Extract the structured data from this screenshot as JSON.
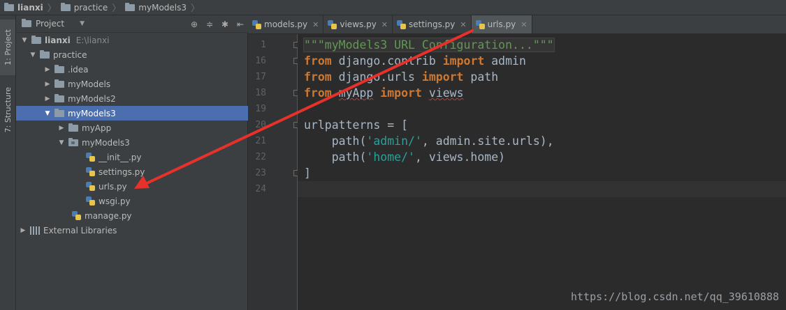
{
  "breadcrumb": {
    "items": [
      "lianxi",
      "practice",
      "myModels3"
    ]
  },
  "toolstrip": {
    "project_tab": "1: Project",
    "structure_tab": "7: Structure"
  },
  "project_panel": {
    "title": "Project",
    "tree": [
      {
        "label": "lianxi",
        "extra": "E:\\lianxi"
      },
      {
        "label": "practice"
      },
      {
        "label": ".idea"
      },
      {
        "label": "myModels"
      },
      {
        "label": "myModels2"
      },
      {
        "label": "myModels3"
      },
      {
        "label": "myApp"
      },
      {
        "label": "myModels3"
      },
      {
        "label": "__init__.py"
      },
      {
        "label": "settings.py"
      },
      {
        "label": "urls.py"
      },
      {
        "label": "wsgi.py"
      },
      {
        "label": "manage.py"
      },
      {
        "label": "External Libraries"
      }
    ]
  },
  "editor": {
    "tabs": [
      {
        "label": "models.py"
      },
      {
        "label": "views.py"
      },
      {
        "label": "settings.py"
      },
      {
        "label": "urls.py",
        "active": true
      }
    ],
    "line_numbers": [
      "1",
      "16",
      "17",
      "18",
      "19",
      "20",
      "21",
      "22",
      "23",
      "24"
    ],
    "code": {
      "l1": "\"\"\"myModels3 URL Configuration...\"\"\"",
      "l16_kw1": "from",
      "l16_mid": " django.contrib ",
      "l16_kw2": "import",
      "l16_end": " admin",
      "l17_kw1": "from",
      "l17_mid": " django.urls ",
      "l17_kw2": "import",
      "l17_end": " path",
      "l18_kw1": "from",
      "l18_mod": "myApp",
      "l18_kw2": "import",
      "l18_end": "views",
      "l20": "urlpatterns = [",
      "l21_a": "    path(",
      "l21_s": "'admin/'",
      "l21_b": ", admin.site.urls),",
      "l22_a": "    path(",
      "l22_s": "'home/'",
      "l22_b": ", views.home)",
      "l23": "]"
    }
  },
  "watermark": "https://blog.csdn.net/qq_39610888",
  "colors": {
    "arrow": "#e8312a",
    "selection": "#4b6eaf",
    "keyword": "#cc7832"
  }
}
